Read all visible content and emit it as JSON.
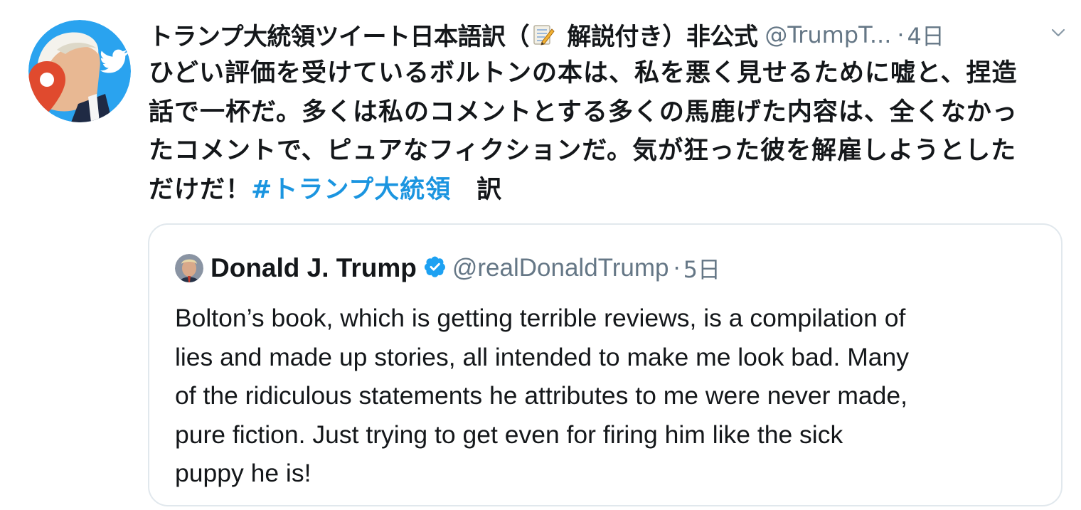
{
  "tweet": {
    "display_name_part1": "トランプ大統領ツイート日本語訳（",
    "display_name_part2": " 解説付き）非公式",
    "emoji_icon": "memo-icon",
    "handle": "@TrumpT...",
    "dot": "·",
    "time": "4日",
    "body_lines": [
      "ひどい評価を受けているボルトンの本は、私を悪く見せるために嘘と、捏造",
      "話で一杯だ。多くは私のコメントとする多くの馬鹿げた内容は、全くなかっ",
      "たコメントで、ピュアなフィクションだ。気が狂った彼を解雇しようとした"
    ],
    "body_last_line_prefix": "だけだ！",
    "hashtag": "#トランプ大統領",
    "suffix": "訳"
  },
  "quoted": {
    "name": "Donald J. Trump",
    "handle": "@realDonaldTrump",
    "dot": "·",
    "time": "5日",
    "text_lines": [
      "Bolton’s book, which is getting terrible reviews, is a compilation of",
      "lies and made up stories, all intended to make me look bad. Many",
      "of the ridiculous statements he attributes to me were never made,",
      "pure fiction. Just trying to get even for firing him like the sick",
      "puppy he is!"
    ]
  },
  "colors": {
    "text": "#14171a",
    "secondary": "#657786",
    "link": "#1b95e0",
    "border": "#e1e8ed",
    "verified": "#1da1f2"
  }
}
